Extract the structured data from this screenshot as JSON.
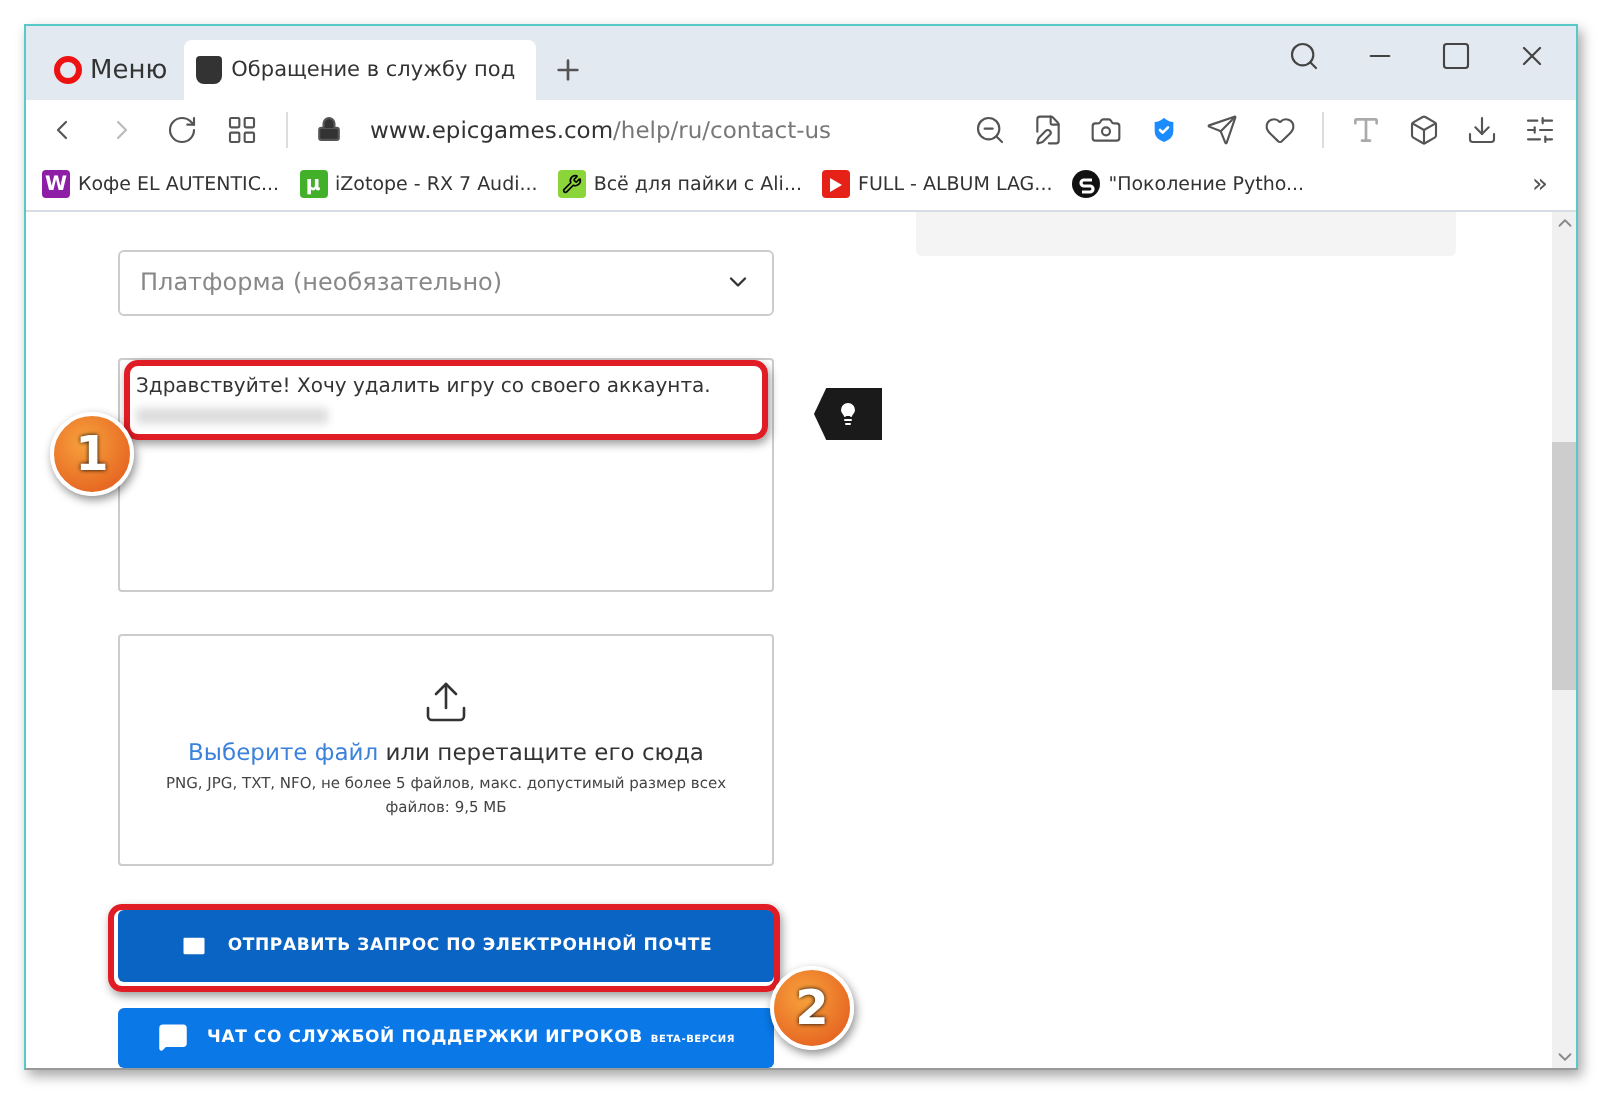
{
  "browser": {
    "menu_button": {
      "label": "Меню"
    },
    "tabs": [
      {
        "title": "Обращение в службу под",
        "selected": true
      }
    ],
    "address": {
      "domain": "www.epicgames.com",
      "path": "/help/ru/contact-us"
    },
    "bookmarks": [
      {
        "label": "Кофе EL AUTENTIC...",
        "kind": "letter",
        "glyph": "W",
        "color": "#8e1ea6"
      },
      {
        "label": "iZotope - RX 7 Audi...",
        "kind": "letter",
        "glyph": "µ",
        "color": "#43b02a"
      },
      {
        "label": "Всё для пайки с Ali...",
        "kind": "tools",
        "color": "#8bd43a"
      },
      {
        "label": "FULL - ALBUM LAG...",
        "kind": "play",
        "color": "#e62117"
      },
      {
        "label": "\"Поколение Pytho...",
        "kind": "swirl",
        "color": "#111111"
      }
    ],
    "bookmarks_more": "»"
  },
  "form": {
    "platform_select": {
      "placeholder": "Платформа (необязательно)"
    },
    "message": {
      "value": "Здравствуйте! Хочу удалить игру со своего аккаунта."
    },
    "upload": {
      "link": "Выберите файл",
      "text": " или перетащите его сюда",
      "hint": "PNG, JPG, TXT, NFO, не более 5 файлов, макс. допустимый размер всех файлов: 9,5 МБ"
    },
    "buttons": [
      {
        "kind": "email",
        "label": "ОТПРАВИТЬ ЗАПРОС ПО ЭЛЕКТРОННОЙ ПОЧТЕ"
      },
      {
        "kind": "chat",
        "label": "ЧАТ СО СЛУЖБОЙ ПОДДЕРЖКИ ИГРОКОВ",
        "badge": "BETA-ВЕРСИЯ"
      }
    ]
  },
  "annotations": [
    {
      "number": "1"
    },
    {
      "number": "2"
    }
  ]
}
